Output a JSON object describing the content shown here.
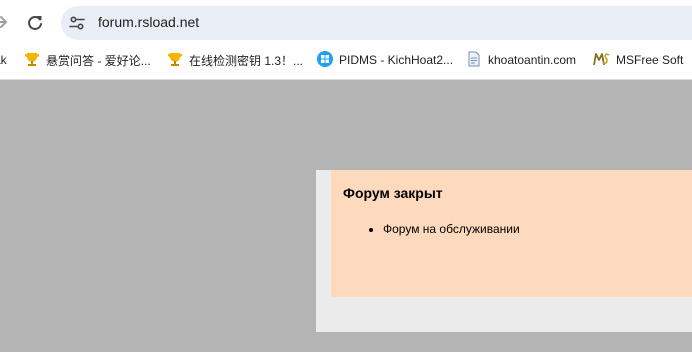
{
  "browser": {
    "url": "forum.rsload.net",
    "forward_icon": "arrow-right-icon",
    "reload_icon": "reload-icon",
    "site_info_icon": "tune-icon"
  },
  "bookmarks": [
    {
      "label": "ak",
      "icon": "none"
    },
    {
      "label": "悬赏问答 - 爱好论...",
      "icon": "trophy-icon"
    },
    {
      "label": "在线检测密钥 1.3！...",
      "icon": "trophy-icon"
    },
    {
      "label": "PIDMS - KichHoat2...",
      "icon": "windows-icon"
    },
    {
      "label": "khoatoantin.com",
      "icon": "document-icon"
    },
    {
      "label": "MSFree Soft",
      "icon": "msfree-logo-icon"
    }
  ],
  "notice": {
    "title": "Форум закрыт",
    "items": [
      "Форум на обслуживании"
    ]
  },
  "colors": {
    "page_background": "#b4b4b4",
    "outer_box": "#ebebeb",
    "notice_background": "#fdd9bd",
    "omnibox": "#e9eef6",
    "trophy": "#f4b400",
    "windows": "#1da1f2"
  }
}
